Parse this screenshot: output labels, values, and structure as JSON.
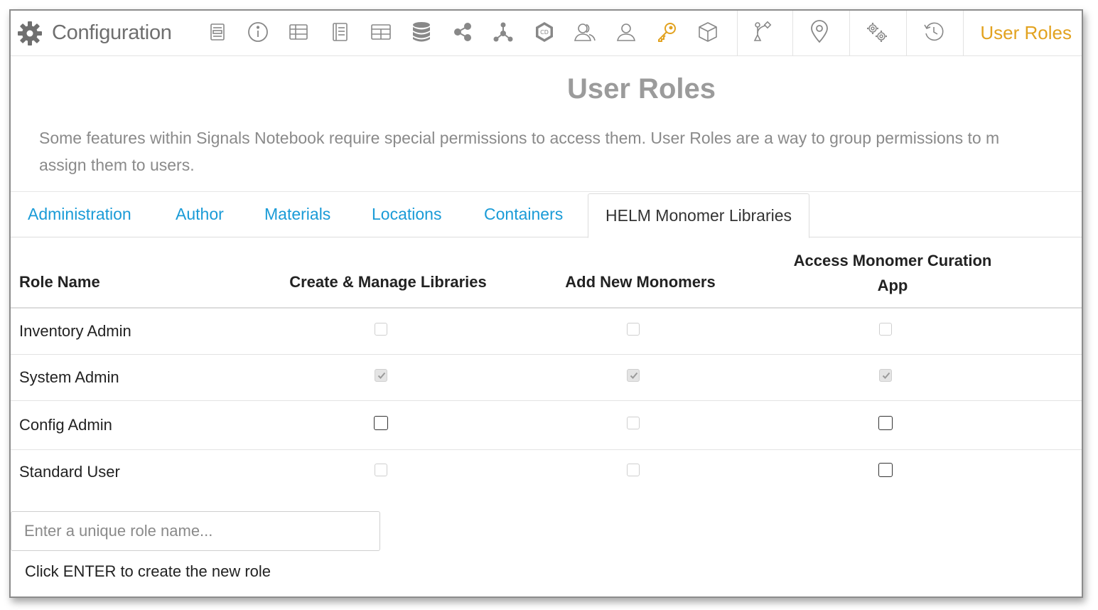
{
  "header": {
    "title": "Configuration",
    "breadcrumb": "User Roles",
    "icons": [
      "gear-icon",
      "form-icon",
      "info-icon",
      "table-icon",
      "notebook-icon",
      "grid-icon",
      "database-icon",
      "share-icon",
      "network-icon",
      "cd-badge-icon",
      "users-icon",
      "user-icon",
      "key-icon",
      "cube-icon",
      "workflow-icon",
      "location-pin-icon",
      "gears-icon",
      "history-icon"
    ],
    "accent_color": "#e2a21f"
  },
  "page": {
    "title": "User Roles",
    "description_line1": "Some features within Signals Notebook require special permissions to access them. User Roles are a way to group permissions to m",
    "description_line2": "assign them to users."
  },
  "tabs": [
    {
      "label": "Administration"
    },
    {
      "label": "Author"
    },
    {
      "label": "Materials"
    },
    {
      "label": "Locations"
    },
    {
      "label": "Containers"
    },
    {
      "label": "HELM Monomer Libraries",
      "active": true
    }
  ],
  "table": {
    "headers": {
      "role_name": "Role Name",
      "create_manage": "Create & Manage Libraries",
      "add_monomers": "Add New Monomers",
      "access_app_line1": "Access Monomer Curation",
      "access_app_line2": "App"
    },
    "rows": [
      {
        "name": "Inventory Admin",
        "perms": [
          {
            "checked": false,
            "enabled": false
          },
          {
            "checked": false,
            "enabled": false
          },
          {
            "checked": false,
            "enabled": false
          }
        ]
      },
      {
        "name": "System Admin",
        "perms": [
          {
            "checked": true,
            "enabled": false
          },
          {
            "checked": true,
            "enabled": false
          },
          {
            "checked": true,
            "enabled": false
          }
        ]
      },
      {
        "name": "Config Admin",
        "perms": [
          {
            "checked": false,
            "enabled": true
          },
          {
            "checked": false,
            "enabled": false
          },
          {
            "checked": false,
            "enabled": true
          }
        ]
      },
      {
        "name": "Standard User",
        "perms": [
          {
            "checked": false,
            "enabled": false
          },
          {
            "checked": false,
            "enabled": false
          },
          {
            "checked": false,
            "enabled": true
          }
        ]
      }
    ]
  },
  "new_role": {
    "placeholder": "Enter a unique role name...",
    "value": "",
    "hint": "Click ENTER to create the new role"
  },
  "colors": {
    "link": "#1a9bd7",
    "title_gray": "#9b9b9b"
  }
}
